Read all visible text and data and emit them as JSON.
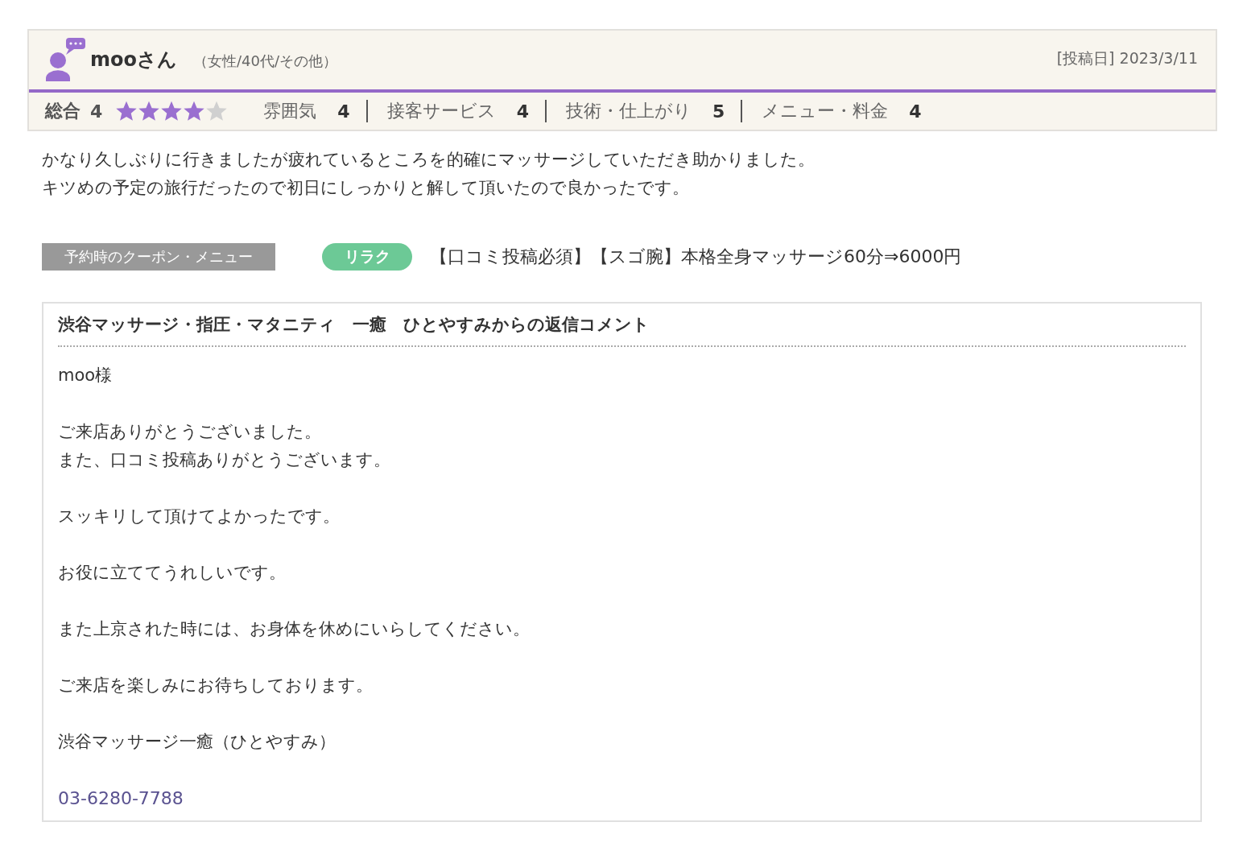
{
  "review": {
    "user_name": "mooさん",
    "user_profile": "（女性/40代/その他）",
    "posted_label": "[投稿日]",
    "posted_date": "2023/3/11",
    "overall_label": "総合",
    "overall_score": "4",
    "stars": 4,
    "ratings": [
      {
        "label": "雰囲気",
        "score": "4"
      },
      {
        "label": "接客サービス",
        "score": "4"
      },
      {
        "label": "技術・仕上がり",
        "score": "5"
      },
      {
        "label": "メニュー・料金",
        "score": "4"
      }
    ],
    "comment": [
      "かなり久しぶりに行きましたが疲れているところを的確にマッサージしていただき助かりました。",
      "キツめの予定の旅行だったので初日にしっかりと解して頂いたので良かったです。"
    ],
    "coupon_label": "予約時のクーポン・メニュー",
    "coupon_tag": "リラク",
    "coupon_text": "【口コミ投稿必須】【スゴ腕】本格全身マッサージ60分⇒6000円"
  },
  "reply": {
    "title": "渋谷マッサージ・指圧・マタニティ　一癒　ひとやすみからの返信コメント",
    "paragraphs": [
      [
        "moo様"
      ],
      [
        "ご来店ありがとうございました。",
        "また、口コミ投稿ありがとうございます。"
      ],
      [
        "スッキリして頂けてよかったです。"
      ],
      [
        "お役に立ててうれしいです。"
      ],
      [
        "また上京された時には、お身体を休めにいらしてください。"
      ],
      [
        "ご来店を楽しみにお待ちしております。"
      ],
      [
        "渋谷マッサージ一癒（ひとやすみ）"
      ]
    ],
    "phone": "03-6280-7788"
  }
}
